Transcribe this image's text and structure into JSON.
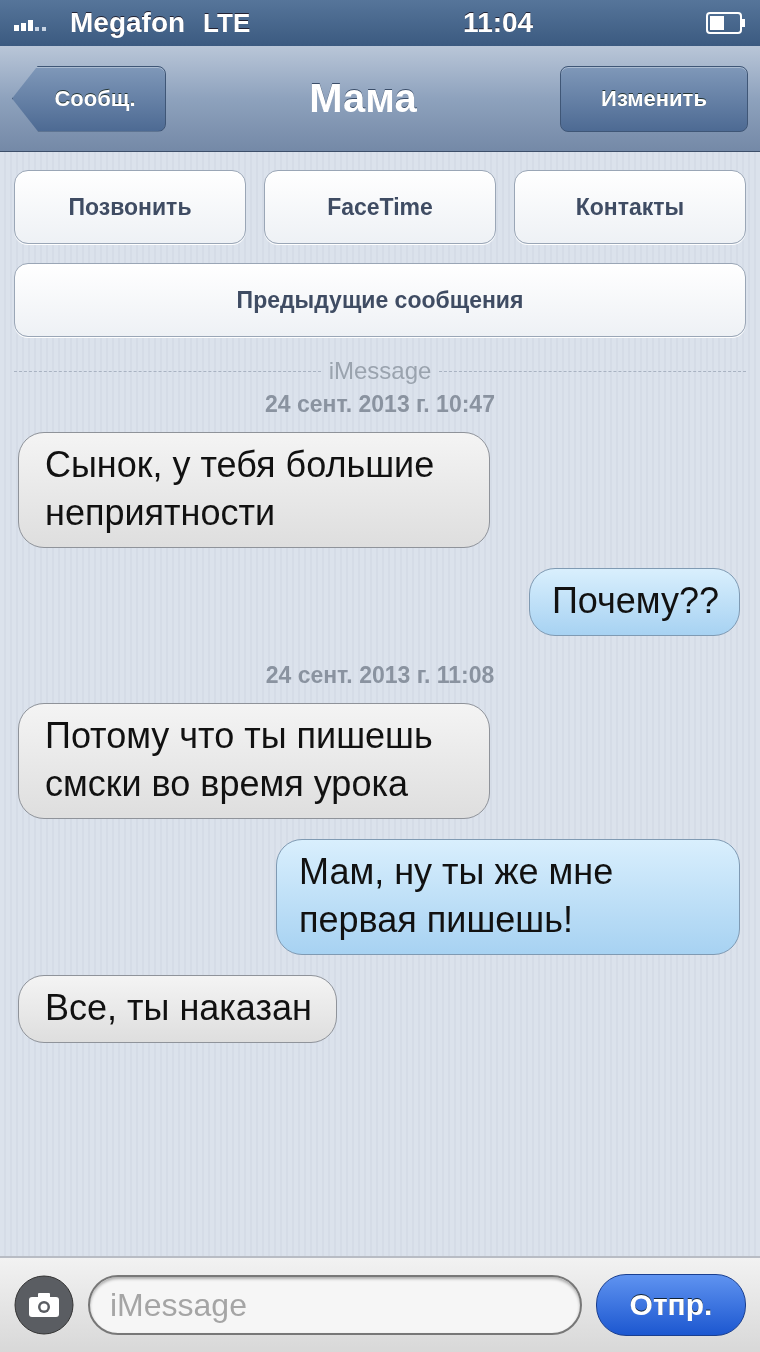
{
  "status_bar": {
    "carrier": "Megafon",
    "network": "LTE",
    "time": "11:04"
  },
  "nav": {
    "back": "Сообщ.",
    "title": "Мама",
    "edit": "Изменить"
  },
  "actions": [
    "Позвонить",
    "FaceTime",
    "Контакты"
  ],
  "earlier": "Предыдущие сообщения",
  "service": "iMessage",
  "thread": [
    {
      "kind": "timestamp",
      "text": "24 сент. 2013 г. 10:47"
    },
    {
      "kind": "received",
      "text": "Сынок, у тебя большие неприятности"
    },
    {
      "kind": "sent",
      "text": "Почему??"
    },
    {
      "kind": "timestamp",
      "text": "24 сент. 2013 г. 11:08"
    },
    {
      "kind": "received",
      "text": "Потому что ты пишешь смски во время урока"
    },
    {
      "kind": "sent",
      "text": "Мам, ну ты же мне первая пишешь!"
    },
    {
      "kind": "received",
      "text": "Все, ты наказан"
    }
  ],
  "composer": {
    "placeholder": "iMessage",
    "send": "Отпр."
  }
}
